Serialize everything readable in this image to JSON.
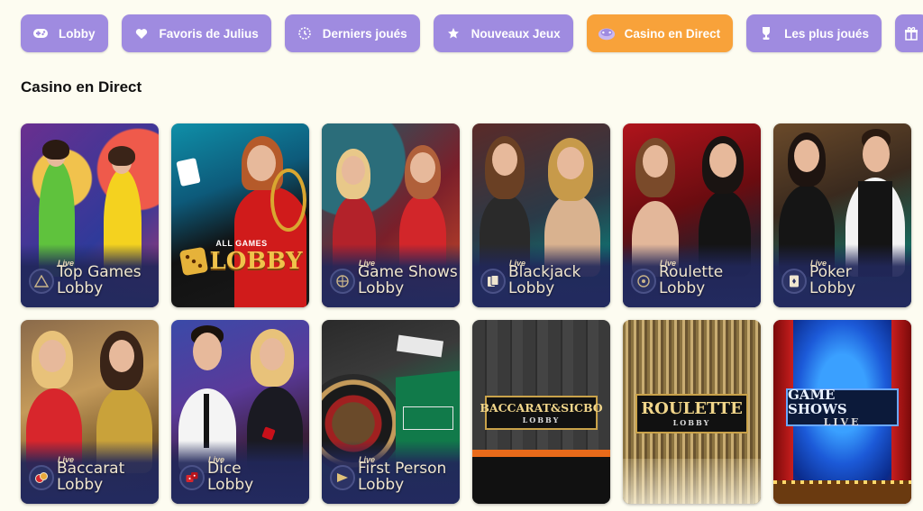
{
  "nav": {
    "tabs": [
      {
        "label": "Lobby",
        "icon": "gamepad-icon"
      },
      {
        "label": "Favoris de Julius",
        "icon": "heart-icon"
      },
      {
        "label": "Derniers joués",
        "icon": "clock-icon"
      },
      {
        "label": "Nouveaux Jeux",
        "icon": "star-icon"
      },
      {
        "label": "Casino en Direct",
        "icon": "live-casino-icon",
        "active": true
      },
      {
        "label": "Les plus joués",
        "icon": "trophy-icon"
      },
      {
        "label": "",
        "icon": "gift-icon"
      }
    ],
    "colors": {
      "tab": "#9f8be0",
      "active_tab": "#f8a23a"
    }
  },
  "section": {
    "title": "Casino en Direct"
  },
  "cards": [
    {
      "live": "Live",
      "line1": "Top Games",
      "line2": "Lobby",
      "icon": "pyramid-icon"
    },
    {
      "logo_top": "ALL GAMES",
      "logo_main": "LOBBY",
      "icon": "dice-icon"
    },
    {
      "live": "Live",
      "line1": "Game Shows",
      "line2": "Lobby",
      "icon": "wheel-icon"
    },
    {
      "live": "Live",
      "line1": "Blackjack",
      "line2": "Lobby",
      "icon": "cards-icon"
    },
    {
      "live": "Live",
      "line1": "Roulette",
      "line2": "Lobby",
      "icon": "roulette-icon"
    },
    {
      "live": "Live",
      "line1": "Poker",
      "line2": "Lobby",
      "icon": "poker-card-icon"
    },
    {
      "live": "Live",
      "line1": "Baccarat",
      "line2": "Lobby",
      "icon": "chips-icon"
    },
    {
      "live": "Live",
      "line1": "Dice",
      "line2": "Lobby",
      "icon": "dice-icon"
    },
    {
      "live": "Live",
      "line1": "First Person",
      "line2": "Lobby",
      "icon": "first-person-icon"
    },
    {
      "plate1": "BACCARAT&SICBO",
      "plate2": "LOBBY"
    },
    {
      "plate1": "ROULETTE",
      "plate2": "LOBBY"
    },
    {
      "plate1": "GAME SHOWS",
      "plate2": "LIVE"
    }
  ]
}
